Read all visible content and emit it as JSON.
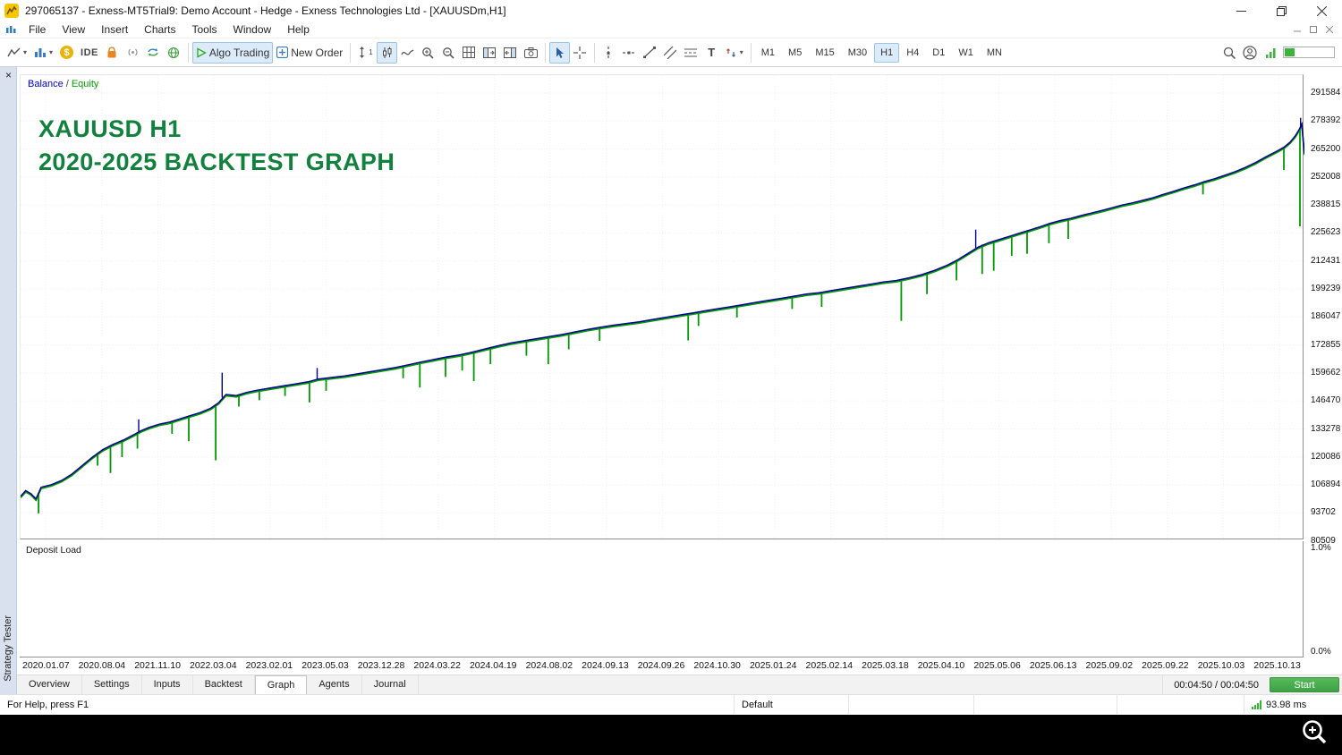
{
  "title_bar": {
    "title": "297065137 - Exness-MT5Trial9: Demo Account - Hedge - Exness Technologies Ltd - [XAUUSDm,H1]"
  },
  "menu": {
    "items": [
      "File",
      "View",
      "Insert",
      "Charts",
      "Tools",
      "Window",
      "Help"
    ]
  },
  "toolbar": {
    "ide_label": "IDE",
    "algo_trading_label": "Algo Trading",
    "new_order_label": "New Order",
    "timeframes": [
      "M1",
      "M5",
      "M15",
      "M30",
      "H1",
      "H4",
      "D1",
      "W1",
      "MN"
    ],
    "active_timeframe": "H1"
  },
  "icons": {
    "caret": "▾",
    "close": "×",
    "dollar": "$",
    "text_tool": "T",
    "scale_one": "1"
  },
  "tester": {
    "panel_title": "Strategy Tester",
    "legend": {
      "balance_label": "Balance",
      "separator": "/",
      "equity_label": "Equity"
    },
    "watermark_line1": "XAUUSD H1",
    "watermark_line2": "2020-2025 BACKTEST GRAPH",
    "deposit_load_label": "Deposit Load",
    "deposit_axis": {
      "top": "1.0%",
      "bottom": "0.0%"
    },
    "tabs": [
      "Overview",
      "Settings",
      "Inputs",
      "Backtest",
      "Graph",
      "Agents",
      "Journal"
    ],
    "active_tab": "Graph",
    "timer": "00:04:50 / 00:04:50",
    "start_button_label": "Start"
  },
  "status_bar": {
    "help_text": "For Help, press F1",
    "profile": "Default",
    "latency": "93.98 ms"
  },
  "chart_data": {
    "type": "line",
    "title": "XAUUSD H1 2020-2025 BACKTEST GRAPH",
    "legend_entries": [
      "Balance",
      "Equity"
    ],
    "grid": true,
    "ylim": [
      80800,
      300000
    ],
    "y_ticks": [
      291584,
      278392,
      265200,
      252008,
      238815,
      225623,
      212431,
      199239,
      186047,
      172855,
      159662,
      146470,
      133278,
      120086,
      106894,
      93702,
      80509
    ],
    "x_tick_labels": [
      "2020.01.07",
      "2020.08.04",
      "2021.11.10",
      "2022.03.04",
      "2023.02.01",
      "2023.05.03",
      "2023.12.28",
      "2024.03.22",
      "2024.04.19",
      "2024.08.02",
      "2024.09.13",
      "2024.09.26",
      "2024.10.30",
      "2025.01.24",
      "2025.02.14",
      "2025.03.18",
      "2025.04.10",
      "2025.05.06",
      "2025.06.13",
      "2025.09.02",
      "2025.09.22",
      "2025.10.03",
      "2025.10.13"
    ],
    "deposit_load_axis": {
      "top_pct": 1.0,
      "bottom_pct": 0.0
    },
    "series": [
      {
        "name": "Balance",
        "color": "#000096",
        "points": [
          [
            0.0,
            101500
          ],
          [
            0.004,
            104200
          ],
          [
            0.008,
            102800
          ],
          [
            0.012,
            100300
          ],
          [
            0.016,
            105800
          ],
          [
            0.024,
            107000
          ],
          [
            0.032,
            109000
          ],
          [
            0.04,
            112000
          ],
          [
            0.048,
            116000
          ],
          [
            0.056,
            120000
          ],
          [
            0.064,
            123500
          ],
          [
            0.072,
            126000
          ],
          [
            0.08,
            128000
          ],
          [
            0.088,
            130500
          ],
          [
            0.094,
            132500
          ],
          [
            0.1,
            134000
          ],
          [
            0.108,
            135500
          ],
          [
            0.116,
            136500
          ],
          [
            0.124,
            138000
          ],
          [
            0.132,
            139500
          ],
          [
            0.14,
            141000
          ],
          [
            0.148,
            143000
          ],
          [
            0.154,
            145500
          ],
          [
            0.16,
            149500
          ],
          [
            0.168,
            149000
          ],
          [
            0.176,
            150500
          ],
          [
            0.184,
            151500
          ],
          [
            0.194,
            152500
          ],
          [
            0.204,
            153500
          ],
          [
            0.214,
            154500
          ],
          [
            0.224,
            155500
          ],
          [
            0.232,
            156800
          ],
          [
            0.242,
            157500
          ],
          [
            0.252,
            158200
          ],
          [
            0.262,
            159200
          ],
          [
            0.272,
            160200
          ],
          [
            0.282,
            161200
          ],
          [
            0.292,
            162200
          ],
          [
            0.302,
            163500
          ],
          [
            0.312,
            164800
          ],
          [
            0.322,
            166000
          ],
          [
            0.332,
            167200
          ],
          [
            0.342,
            168200
          ],
          [
            0.352,
            169500
          ],
          [
            0.362,
            171000
          ],
          [
            0.372,
            172500
          ],
          [
            0.382,
            173800
          ],
          [
            0.392,
            174800
          ],
          [
            0.402,
            175800
          ],
          [
            0.412,
            176800
          ],
          [
            0.422,
            177800
          ],
          [
            0.432,
            179000
          ],
          [
            0.442,
            180200
          ],
          [
            0.452,
            181200
          ],
          [
            0.462,
            182200
          ],
          [
            0.472,
            183000
          ],
          [
            0.482,
            183800
          ],
          [
            0.492,
            184800
          ],
          [
            0.502,
            185800
          ],
          [
            0.512,
            186800
          ],
          [
            0.522,
            187800
          ],
          [
            0.532,
            188800
          ],
          [
            0.542,
            189800
          ],
          [
            0.552,
            190800
          ],
          [
            0.562,
            191800
          ],
          [
            0.572,
            192800
          ],
          [
            0.582,
            193800
          ],
          [
            0.592,
            194800
          ],
          [
            0.602,
            195800
          ],
          [
            0.612,
            196800
          ],
          [
            0.622,
            197500
          ],
          [
            0.632,
            198500
          ],
          [
            0.642,
            199500
          ],
          [
            0.652,
            200500
          ],
          [
            0.662,
            201500
          ],
          [
            0.672,
            202500
          ],
          [
            0.682,
            203200
          ],
          [
            0.692,
            204500
          ],
          [
            0.702,
            206000
          ],
          [
            0.712,
            208000
          ],
          [
            0.722,
            210500
          ],
          [
            0.73,
            213000
          ],
          [
            0.738,
            216000
          ],
          [
            0.746,
            219000
          ],
          [
            0.754,
            221000
          ],
          [
            0.762,
            222500
          ],
          [
            0.77,
            224000
          ],
          [
            0.778,
            225500
          ],
          [
            0.786,
            227000
          ],
          [
            0.794,
            228500
          ],
          [
            0.802,
            230200
          ],
          [
            0.81,
            231500
          ],
          [
            0.818,
            232500
          ],
          [
            0.826,
            233800
          ],
          [
            0.834,
            235000
          ],
          [
            0.842,
            236200
          ],
          [
            0.85,
            237500
          ],
          [
            0.858,
            238800
          ],
          [
            0.866,
            239800
          ],
          [
            0.874,
            241000
          ],
          [
            0.882,
            242200
          ],
          [
            0.89,
            243800
          ],
          [
            0.898,
            245200
          ],
          [
            0.906,
            246800
          ],
          [
            0.914,
            248200
          ],
          [
            0.922,
            249800
          ],
          [
            0.93,
            251200
          ],
          [
            0.938,
            252800
          ],
          [
            0.946,
            254500
          ],
          [
            0.954,
            256500
          ],
          [
            0.962,
            258800
          ],
          [
            0.97,
            261500
          ],
          [
            0.978,
            264000
          ],
          [
            0.984,
            266000
          ],
          [
            0.989,
            268500
          ],
          [
            0.993,
            271500
          ],
          [
            0.996,
            274500
          ],
          [
            0.998,
            277000
          ],
          [
            1.0,
            263000
          ]
        ],
        "spikes_up": [
          [
            0.092,
            132000,
            137800
          ],
          [
            0.157,
            148000,
            159800
          ],
          [
            0.231,
            156700,
            162000
          ],
          [
            0.744,
            218600,
            227200
          ],
          [
            0.997,
            275500,
            279900
          ]
        ]
      },
      {
        "name": "Equity",
        "color": "#009a00",
        "spikes": [
          [
            0.014,
            103000,
            93500
          ],
          [
            0.06,
            122000,
            116000
          ],
          [
            0.07,
            125500,
            112500
          ],
          [
            0.079,
            127800,
            120000
          ],
          [
            0.091,
            131800,
            124000
          ],
          [
            0.118,
            136800,
            131000
          ],
          [
            0.131,
            139300,
            127500
          ],
          [
            0.152,
            144800,
            118500
          ],
          [
            0.17,
            149200,
            143800
          ],
          [
            0.186,
            151700,
            146800
          ],
          [
            0.206,
            153700,
            148800
          ],
          [
            0.225,
            155600,
            145800
          ],
          [
            0.238,
            157200,
            151300
          ],
          [
            0.298,
            163000,
            157200
          ],
          [
            0.311,
            164700,
            152800
          ],
          [
            0.331,
            167100,
            157800
          ],
          [
            0.344,
            168400,
            160800
          ],
          [
            0.353,
            169600,
            155800
          ],
          [
            0.366,
            171600,
            163800
          ],
          [
            0.394,
            175000,
            167800
          ],
          [
            0.411,
            176700,
            163800
          ],
          [
            0.427,
            178300,
            170800
          ],
          [
            0.451,
            181100,
            174800
          ],
          [
            0.52,
            187600,
            175000
          ],
          [
            0.528,
            188400,
            181800
          ],
          [
            0.558,
            191400,
            185800
          ],
          [
            0.601,
            195700,
            189800
          ],
          [
            0.624,
            197600,
            190800
          ],
          [
            0.686,
            203500,
            184200
          ],
          [
            0.706,
            206700,
            196800
          ],
          [
            0.729,
            212700,
            203300
          ],
          [
            0.749,
            220200,
            206300
          ],
          [
            0.758,
            221800,
            207800
          ],
          [
            0.772,
            224300,
            214800
          ],
          [
            0.784,
            226600,
            215800
          ],
          [
            0.801,
            230000,
            220800
          ],
          [
            0.816,
            232300,
            222800
          ],
          [
            0.921,
            249600,
            243800
          ],
          [
            0.984,
            266000,
            255300
          ],
          [
            0.9965,
            275000,
            228800
          ]
        ]
      }
    ]
  }
}
